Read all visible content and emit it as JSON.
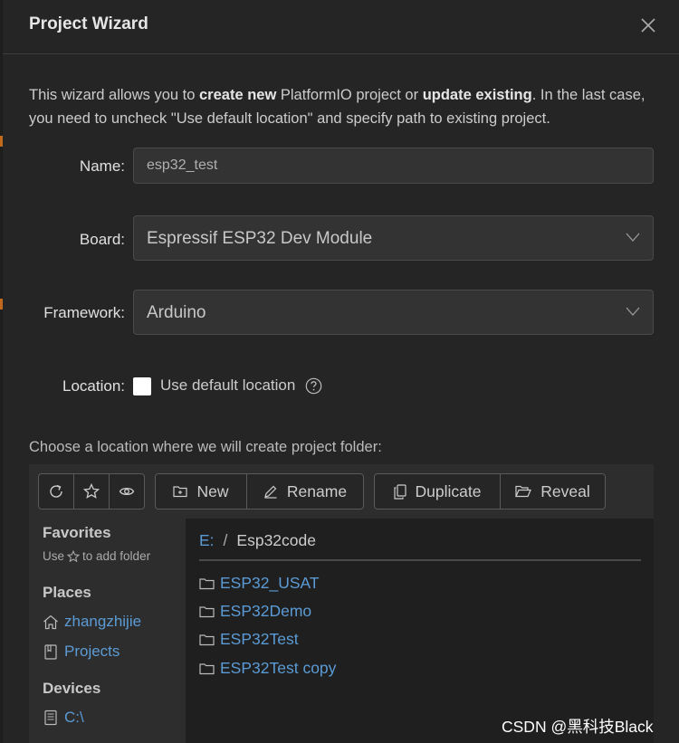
{
  "dialog": {
    "title": "Project Wizard",
    "intro_part1": "This wizard allows you to ",
    "intro_bold1": "create new",
    "intro_part2": " PlatformIO project or ",
    "intro_bold2": "update existing",
    "intro_part3": ". In the last case, you need to uncheck \"Use default location\" and specify path to existing project."
  },
  "form": {
    "name_label": "Name:",
    "name_value": "esp32_test",
    "board_label": "Board:",
    "board_value": "Espressif ESP32 Dev Module",
    "framework_label": "Framework:",
    "framework_value": "Arduino",
    "location_label": "Location:",
    "use_default_label": "Use default location",
    "use_default_checked": false
  },
  "browser": {
    "prompt": "Choose a location where we will create project folder:",
    "toolbar": {
      "new_label": "New",
      "rename_label": "Rename",
      "duplicate_label": "Duplicate",
      "reveal_label": "Reveal"
    },
    "sidebar": {
      "favorites_heading": "Favorites",
      "favorites_hint_prefix": "Use",
      "favorites_hint_suffix": "to add folder",
      "places_heading": "Places",
      "places": [
        "zhangzhijie",
        "Projects"
      ],
      "devices_heading": "Devices",
      "devices": [
        "C:\\"
      ]
    },
    "breadcrumb": {
      "drive": "E:",
      "separator": "/",
      "current": "Esp32code"
    },
    "folders": [
      "ESP32_USAT",
      "ESP32Demo",
      "ESP32Test",
      "ESP32Test copy"
    ]
  },
  "watermark": "CSDN @黑科技Black",
  "colors": {
    "link": "#5b9bd5",
    "dialog_bg": "#252526",
    "accent_strip": "#c26a1b"
  }
}
